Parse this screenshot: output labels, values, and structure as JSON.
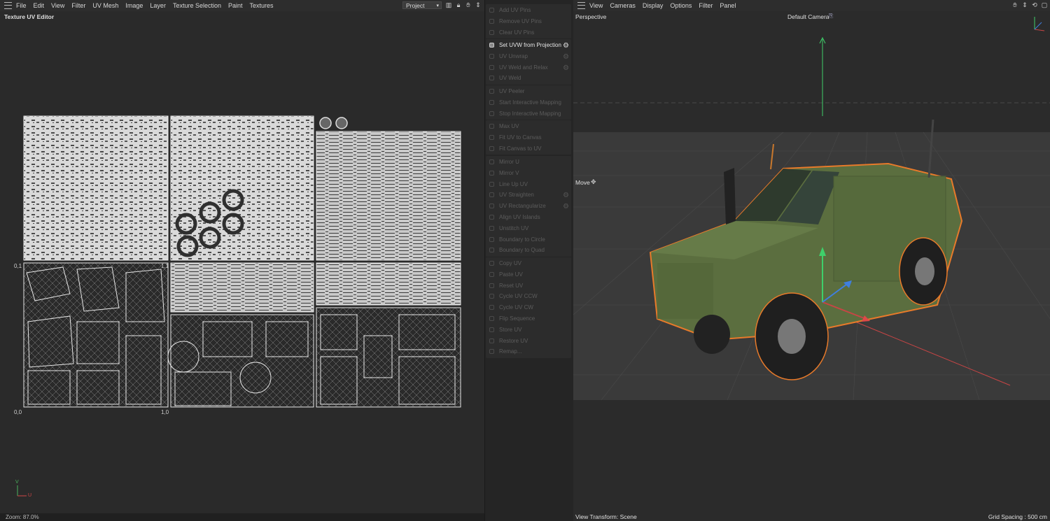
{
  "uv_editor": {
    "menu": [
      "File",
      "Edit",
      "View",
      "Filter",
      "UV Mesh",
      "Image",
      "Layer",
      "Texture Selection",
      "Paint",
      "Textures"
    ],
    "project_select": "Project",
    "title": "Texture UV Editor",
    "coords": {
      "top_left": "0,1",
      "top_right": "1,1",
      "bottom_left": "0,0",
      "bottom_right": "1,0"
    },
    "axis": {
      "v": "V",
      "u": "U"
    },
    "zoom": "Zoom: 87.0%"
  },
  "commands": {
    "groups": [
      [
        {
          "label": "Add UV Pins",
          "enabled": false,
          "gear": false
        },
        {
          "label": "Remove UV Pins",
          "enabled": false,
          "gear": false
        },
        {
          "label": "Clear UV Pins",
          "enabled": false,
          "gear": false
        }
      ],
      [
        {
          "label": "Set UVW from Projection",
          "enabled": true,
          "gear": true
        },
        {
          "label": "UV Unwrap",
          "enabled": false,
          "gear": true
        },
        {
          "label": "UV Weld and Relax",
          "enabled": false,
          "gear": true
        },
        {
          "label": "UV Weld",
          "enabled": false,
          "gear": false
        }
      ],
      [
        {
          "label": "UV Peeler",
          "enabled": false,
          "gear": false
        },
        {
          "label": "Start Interactive Mapping",
          "enabled": false,
          "gear": false
        },
        {
          "label": "Stop Interactive Mapping",
          "enabled": false,
          "gear": false
        }
      ],
      [
        {
          "label": "Max UV",
          "enabled": false,
          "gear": false
        },
        {
          "label": "Fit UV to Canvas",
          "enabled": false,
          "gear": false
        },
        {
          "label": "Fit Canvas to UV",
          "enabled": false,
          "gear": false
        }
      ],
      [
        {
          "label": "Mirror U",
          "enabled": false,
          "gear": false
        },
        {
          "label": "Mirror V",
          "enabled": false,
          "gear": false
        },
        {
          "label": "Line Up UV",
          "enabled": false,
          "gear": false
        },
        {
          "label": "UV Straighten",
          "enabled": false,
          "gear": true
        },
        {
          "label": "UV Rectangularize",
          "enabled": false,
          "gear": true
        },
        {
          "label": "Align UV Islands",
          "enabled": false,
          "gear": false
        },
        {
          "label": "Unstitch UV",
          "enabled": false,
          "gear": false
        },
        {
          "label": "Boundary to Circle",
          "enabled": false,
          "gear": false
        },
        {
          "label": "Boundary to Quad",
          "enabled": false,
          "gear": false
        }
      ],
      [
        {
          "label": "Copy UV",
          "enabled": false,
          "gear": false
        },
        {
          "label": "Paste UV",
          "enabled": false,
          "gear": false
        },
        {
          "label": "Reset UV",
          "enabled": false,
          "gear": false
        },
        {
          "label": "Cycle UV CCW",
          "enabled": false,
          "gear": false
        },
        {
          "label": "Cycle UV CW",
          "enabled": false,
          "gear": false
        },
        {
          "label": "Flip Sequence",
          "enabled": false,
          "gear": false
        },
        {
          "label": "Store UV",
          "enabled": false,
          "gear": false
        },
        {
          "label": "Restore UV",
          "enabled": false,
          "gear": false
        },
        {
          "label": "Remap...",
          "enabled": false,
          "gear": false
        }
      ]
    ]
  },
  "viewport": {
    "menu": [
      "View",
      "Cameras",
      "Display",
      "Options",
      "Filter",
      "Panel"
    ],
    "view_name": "Perspective",
    "camera": "Default Camera",
    "tool": "Move",
    "view_transform": "View Transform: Scene",
    "grid_spacing": "Grid Spacing : 500 cm",
    "axis_colors": {
      "x": "#e04848",
      "y": "#3fcf6a",
      "z": "#3f7fe0"
    },
    "selection_color": "#e87a2a"
  }
}
